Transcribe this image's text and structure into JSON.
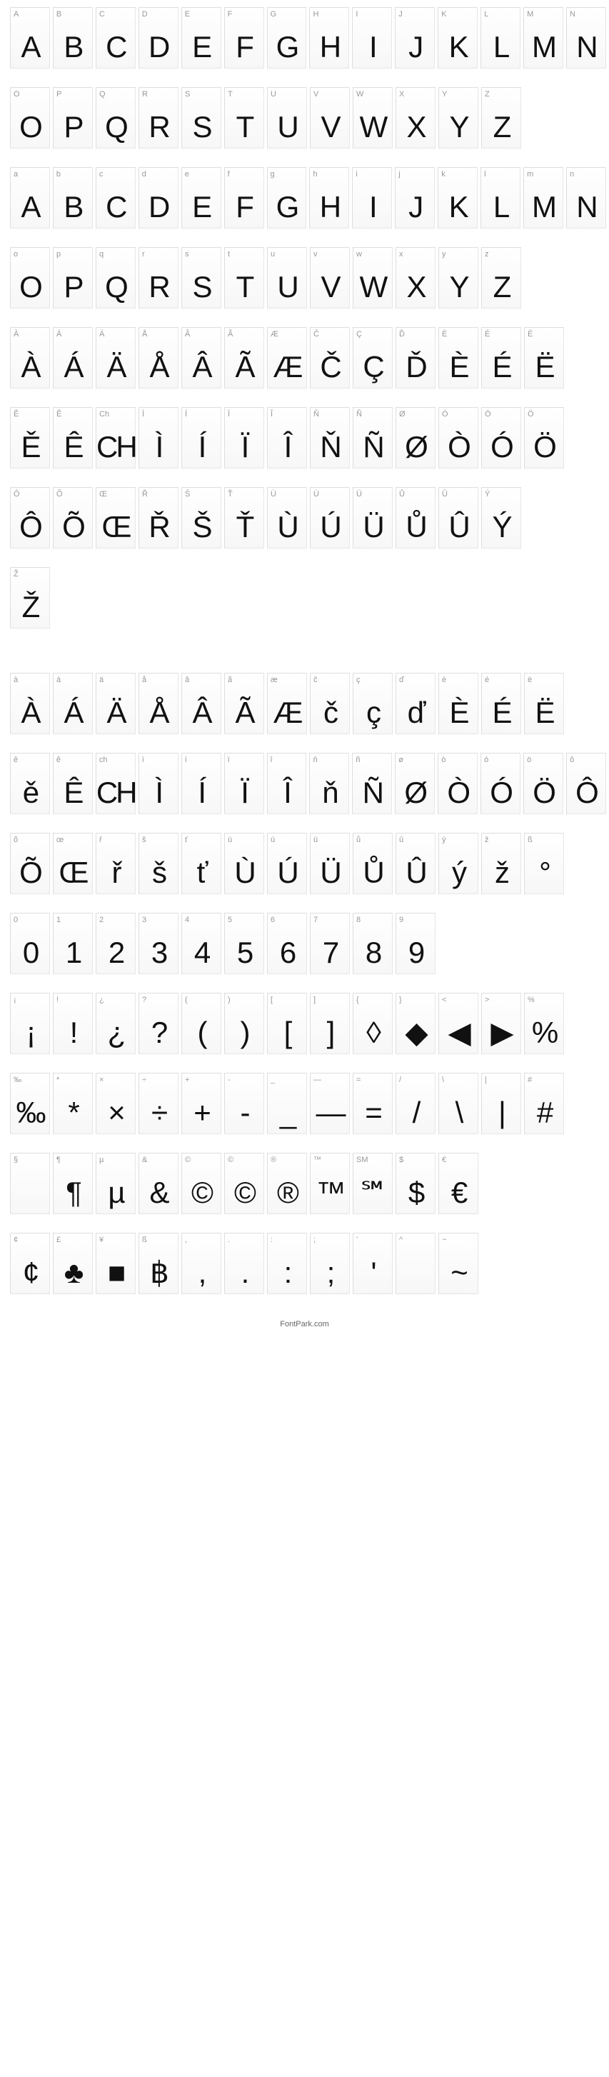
{
  "rows": [
    [
      {
        "k": "A",
        "g": "A"
      },
      {
        "k": "B",
        "g": "B"
      },
      {
        "k": "C",
        "g": "C"
      },
      {
        "k": "D",
        "g": "D"
      },
      {
        "k": "E",
        "g": "E"
      },
      {
        "k": "F",
        "g": "F"
      },
      {
        "k": "G",
        "g": "G"
      },
      {
        "k": "H",
        "g": "H"
      },
      {
        "k": "I",
        "g": "I"
      },
      {
        "k": "J",
        "g": "J"
      },
      {
        "k": "K",
        "g": "K"
      },
      {
        "k": "L",
        "g": "L"
      },
      {
        "k": "M",
        "g": "M"
      },
      {
        "k": "N",
        "g": "N"
      }
    ],
    [
      {
        "k": "O",
        "g": "O"
      },
      {
        "k": "P",
        "g": "P"
      },
      {
        "k": "Q",
        "g": "Q"
      },
      {
        "k": "R",
        "g": "R"
      },
      {
        "k": "S",
        "g": "S"
      },
      {
        "k": "T",
        "g": "T"
      },
      {
        "k": "U",
        "g": "U"
      },
      {
        "k": "V",
        "g": "V"
      },
      {
        "k": "W",
        "g": "W"
      },
      {
        "k": "X",
        "g": "X"
      },
      {
        "k": "Y",
        "g": "Y"
      },
      {
        "k": "Z",
        "g": "Z"
      }
    ],
    [
      {
        "k": "a",
        "g": "A"
      },
      {
        "k": "b",
        "g": "B"
      },
      {
        "k": "c",
        "g": "C"
      },
      {
        "k": "d",
        "g": "D"
      },
      {
        "k": "e",
        "g": "E"
      },
      {
        "k": "f",
        "g": "F"
      },
      {
        "k": "g",
        "g": "G"
      },
      {
        "k": "h",
        "g": "H"
      },
      {
        "k": "i",
        "g": "I"
      },
      {
        "k": "j",
        "g": "J"
      },
      {
        "k": "k",
        "g": "K"
      },
      {
        "k": "l",
        "g": "L"
      },
      {
        "k": "m",
        "g": "M"
      },
      {
        "k": "n",
        "g": "N"
      }
    ],
    [
      {
        "k": "o",
        "g": "O"
      },
      {
        "k": "p",
        "g": "P"
      },
      {
        "k": "q",
        "g": "Q"
      },
      {
        "k": "r",
        "g": "R"
      },
      {
        "k": "s",
        "g": "S"
      },
      {
        "k": "t",
        "g": "T"
      },
      {
        "k": "u",
        "g": "U"
      },
      {
        "k": "v",
        "g": "V"
      },
      {
        "k": "w",
        "g": "W"
      },
      {
        "k": "x",
        "g": "X"
      },
      {
        "k": "y",
        "g": "Y"
      },
      {
        "k": "z",
        "g": "Z"
      }
    ],
    [
      {
        "k": "À",
        "g": "À"
      },
      {
        "k": "Á",
        "g": "Á"
      },
      {
        "k": "Ä",
        "g": "Ä"
      },
      {
        "k": "Å",
        "g": "Å"
      },
      {
        "k": "Â",
        "g": "Â"
      },
      {
        "k": "Ã",
        "g": "Ã"
      },
      {
        "k": "Æ",
        "g": "Æ"
      },
      {
        "k": "Č",
        "g": "Č"
      },
      {
        "k": "Ç",
        "g": "Ç"
      },
      {
        "k": "Ď",
        "g": "Ď"
      },
      {
        "k": "È",
        "g": "È"
      },
      {
        "k": "É",
        "g": "É"
      },
      {
        "k": "Ë",
        "g": "Ë"
      }
    ],
    [
      {
        "k": "Ě",
        "g": "Ě"
      },
      {
        "k": "Ê",
        "g": "Ê"
      },
      {
        "k": "Ch",
        "g": "CH"
      },
      {
        "k": "Ì",
        "g": "Ì"
      },
      {
        "k": "Í",
        "g": "Í"
      },
      {
        "k": "Ï",
        "g": "Ï"
      },
      {
        "k": "Î",
        "g": "Î"
      },
      {
        "k": "Ň",
        "g": "Ň"
      },
      {
        "k": "Ñ",
        "g": "Ñ"
      },
      {
        "k": "Ø",
        "g": "Ø"
      },
      {
        "k": "Ò",
        "g": "Ò"
      },
      {
        "k": "Ó",
        "g": "Ó"
      },
      {
        "k": "Ö",
        "g": "Ö"
      }
    ],
    [
      {
        "k": "Ô",
        "g": "Ô"
      },
      {
        "k": "Õ",
        "g": "Õ"
      },
      {
        "k": "Œ",
        "g": "Œ"
      },
      {
        "k": "Ř",
        "g": "Ř"
      },
      {
        "k": "Š",
        "g": "Š"
      },
      {
        "k": "Ť",
        "g": "Ť"
      },
      {
        "k": "Ù",
        "g": "Ù"
      },
      {
        "k": "Ú",
        "g": "Ú"
      },
      {
        "k": "Ü",
        "g": "Ü"
      },
      {
        "k": "Ů",
        "g": "Ů"
      },
      {
        "k": "Û",
        "g": "Û"
      },
      {
        "k": "Ý",
        "g": "Ý"
      }
    ],
    [
      {
        "k": "Ž",
        "g": "Ž"
      }
    ],
    [
      {
        "k": "à",
        "g": "À"
      },
      {
        "k": "á",
        "g": "Á"
      },
      {
        "k": "ä",
        "g": "Ä"
      },
      {
        "k": "å",
        "g": "Å"
      },
      {
        "k": "â",
        "g": "Â"
      },
      {
        "k": "ã",
        "g": "Ã"
      },
      {
        "k": "æ",
        "g": "Æ"
      },
      {
        "k": "č",
        "g": "č"
      },
      {
        "k": "ç",
        "g": "ç"
      },
      {
        "k": "ď",
        "g": "ď"
      },
      {
        "k": "è",
        "g": "È"
      },
      {
        "k": "é",
        "g": "É"
      },
      {
        "k": "ë",
        "g": "Ë"
      }
    ],
    [
      {
        "k": "ě",
        "g": "ě"
      },
      {
        "k": "ê",
        "g": "Ê"
      },
      {
        "k": "ch",
        "g": "CH"
      },
      {
        "k": "ì",
        "g": "Ì"
      },
      {
        "k": "í",
        "g": "Í"
      },
      {
        "k": "ï",
        "g": "Ï"
      },
      {
        "k": "î",
        "g": "Î"
      },
      {
        "k": "ň",
        "g": "ň"
      },
      {
        "k": "ñ",
        "g": "Ñ"
      },
      {
        "k": "ø",
        "g": "Ø"
      },
      {
        "k": "ò",
        "g": "Ò"
      },
      {
        "k": "ó",
        "g": "Ó"
      },
      {
        "k": "ö",
        "g": "Ö"
      },
      {
        "k": "ô",
        "g": "Ô"
      }
    ],
    [
      {
        "k": "õ",
        "g": "Õ"
      },
      {
        "k": "œ",
        "g": "Œ"
      },
      {
        "k": "ř",
        "g": "ř"
      },
      {
        "k": "š",
        "g": "š"
      },
      {
        "k": "ť",
        "g": "ť"
      },
      {
        "k": "ù",
        "g": "Ù"
      },
      {
        "k": "ú",
        "g": "Ú"
      },
      {
        "k": "ü",
        "g": "Ü"
      },
      {
        "k": "ů",
        "g": "Ů"
      },
      {
        "k": "û",
        "g": "Û"
      },
      {
        "k": "ý",
        "g": "ý"
      },
      {
        "k": "ž",
        "g": "ž"
      },
      {
        "k": "ß",
        "g": "°"
      }
    ],
    [
      {
        "k": "0",
        "g": "0"
      },
      {
        "k": "1",
        "g": "1"
      },
      {
        "k": "2",
        "g": "2"
      },
      {
        "k": "3",
        "g": "3"
      },
      {
        "k": "4",
        "g": "4"
      },
      {
        "k": "5",
        "g": "5"
      },
      {
        "k": "6",
        "g": "6"
      },
      {
        "k": "7",
        "g": "7"
      },
      {
        "k": "8",
        "g": "8"
      },
      {
        "k": "9",
        "g": "9"
      }
    ],
    [
      {
        "k": "¡",
        "g": "¡"
      },
      {
        "k": "!",
        "g": "!"
      },
      {
        "k": "¿",
        "g": "¿"
      },
      {
        "k": "?",
        "g": "?"
      },
      {
        "k": "(",
        "g": "("
      },
      {
        "k": ")",
        "g": ")"
      },
      {
        "k": "[",
        "g": "["
      },
      {
        "k": "]",
        "g": "]"
      },
      {
        "k": "{",
        "g": "◊"
      },
      {
        "k": "}",
        "g": "◆"
      },
      {
        "k": "<",
        "g": "◀"
      },
      {
        "k": ">",
        "g": "▶"
      },
      {
        "k": "%",
        "g": "%"
      }
    ],
    [
      {
        "k": "‰",
        "g": "‰"
      },
      {
        "k": "*",
        "g": "*"
      },
      {
        "k": "×",
        "g": "×"
      },
      {
        "k": "÷",
        "g": "÷"
      },
      {
        "k": "+",
        "g": "+"
      },
      {
        "k": "-",
        "g": "-"
      },
      {
        "k": "_",
        "g": "_"
      },
      {
        "k": "—",
        "g": "—"
      },
      {
        "k": "=",
        "g": "="
      },
      {
        "k": "/",
        "g": "/"
      },
      {
        "k": "\\",
        "g": "\\"
      },
      {
        "k": "|",
        "g": "|"
      },
      {
        "k": "#",
        "g": "#"
      }
    ],
    [
      {
        "k": "§",
        "g": ""
      },
      {
        "k": "¶",
        "g": "¶"
      },
      {
        "k": "µ",
        "g": "µ"
      },
      {
        "k": "&",
        "g": "&"
      },
      {
        "k": "©",
        "g": "©"
      },
      {
        "k": "©",
        "g": "©"
      },
      {
        "k": "®",
        "g": "®"
      },
      {
        "k": "™",
        "g": "™"
      },
      {
        "k": "SM",
        "g": "℠"
      },
      {
        "k": "$",
        "g": "$"
      },
      {
        "k": "€",
        "g": "€"
      }
    ],
    [
      {
        "k": "¢",
        "g": "¢"
      },
      {
        "k": "£",
        "g": "♣"
      },
      {
        "k": "¥",
        "g": "■"
      },
      {
        "k": "ß",
        "g": "฿"
      },
      {
        "k": ",",
        "g": ","
      },
      {
        "k": ".",
        "g": "."
      },
      {
        "k": ":",
        "g": ":"
      },
      {
        "k": ";",
        "g": ";"
      },
      {
        "k": "'",
        "g": "'"
      },
      {
        "k": "^",
        "g": ""
      },
      {
        "k": "~",
        "g": "~"
      }
    ]
  ],
  "gaps_before": [
    8
  ],
  "footer": "FontPark.com"
}
